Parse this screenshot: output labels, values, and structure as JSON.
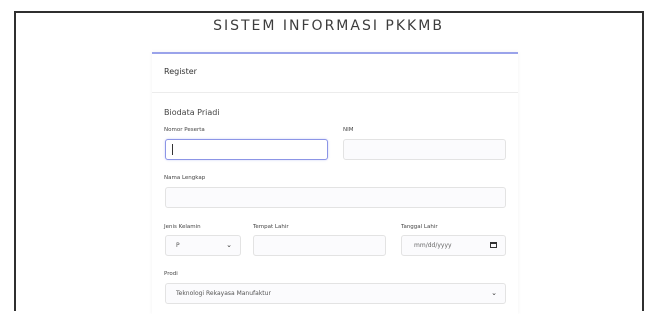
{
  "app": {
    "title": "SISTEM INFORMASI PKKMB"
  },
  "card": {
    "header": "Register"
  },
  "form": {
    "section_title": "Biodata Priadi",
    "nomor_peserta": {
      "label": "Nomor Peserta",
      "value": ""
    },
    "nim": {
      "label": "NIM",
      "value": ""
    },
    "nama_lengkap": {
      "label": "Nama Lengkap",
      "value": ""
    },
    "jenis_kelamin": {
      "label": "Jenis Kelamin",
      "value": "P"
    },
    "tempat_lahir": {
      "label": "Tempat Lahir",
      "value": ""
    },
    "tanggal_lahir": {
      "label": "Tanggal Lahir",
      "placeholder": "mm/dd/yyyy"
    },
    "prodi": {
      "label": "Prodi",
      "value": "Teknologi Rekayasa Manufaktur"
    }
  },
  "colors": {
    "accent": "#9aa3ea",
    "focus": "#8c95e6",
    "frame": "#2f2f2f"
  },
  "icons": {
    "select": "chevron-down-icon",
    "date": "calendar-icon"
  }
}
